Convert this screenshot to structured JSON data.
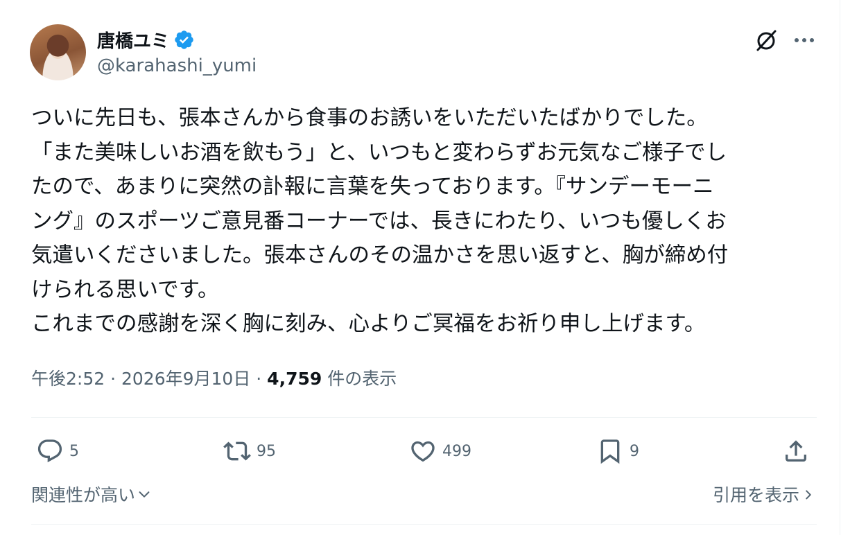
{
  "author": {
    "name": "唐橋ユミ",
    "handle": "@karahashi_yumi",
    "verified_color": "#1d9bf0"
  },
  "header": {
    "grok_icon": "grok-slash-icon",
    "more_icon": "more-horizontal-icon"
  },
  "tweet": {
    "lines": [
      "ついに先日も、張本さんから食事のお誘いをいただいたばかりでした。",
      "「また美味しいお酒を飲もう」と、いつもと変わらずお元気なご様子でし",
      "たので、あまりに突然の訃報に言葉を失っております。『サンデーモーニ",
      "ング』のスポーツご意見番コーナーでは、長きにわたり、いつも優しくお",
      "気遣いくださいました。張本さんのその温かさを思い返すと、胸が締め付",
      "けられる思いです。",
      "これまでの感謝を深く胸に刻み、心よりご冥福をお祈り申し上げます。"
    ]
  },
  "meta": {
    "time": "午後2:52",
    "date": "2026年9月10日",
    "sep": " · ",
    "views": "4,759",
    "views_label": " 件の表示"
  },
  "actions": {
    "replies": "5",
    "reposts": "95",
    "likes": "499",
    "bookmarks": "9"
  },
  "footer": {
    "sort_label": "関連性が高い",
    "quotes_label": "引用を表示"
  },
  "colors": {
    "text": "#0f1419",
    "secondary": "#536471",
    "border": "#eff3f4",
    "accent": "#1d9bf0"
  }
}
